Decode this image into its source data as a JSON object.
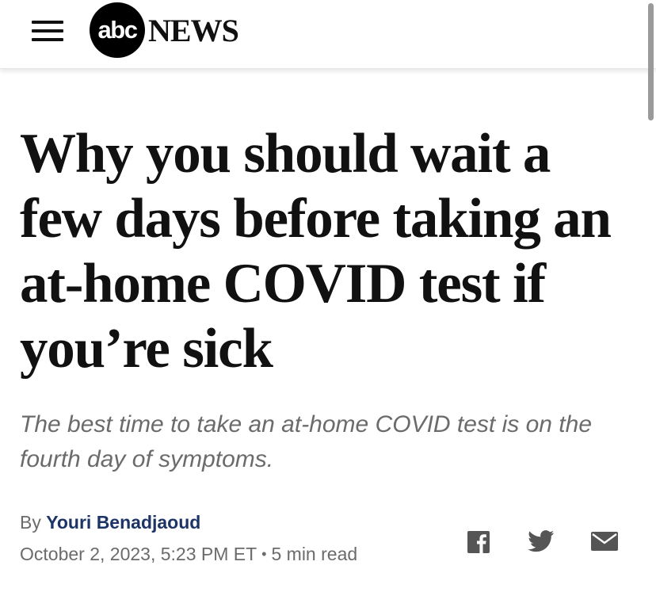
{
  "header": {
    "logo_abc": "abc",
    "logo_news": "NEWS"
  },
  "article": {
    "headline": "Why you should wait a few days before taking an at-home COVID test if you’re sick",
    "subheadline": "The best time to take an at-home COVID test is on the fourth day of symptoms.",
    "byline_prefix": "By",
    "author": "Youri Benadjaoud",
    "date": "October 2, 2023, 5:23 PM ET",
    "separator": "•",
    "read_time": "5 min read"
  },
  "share": {
    "icons": [
      "facebook-icon",
      "twitter-icon",
      "email-icon"
    ]
  },
  "colors": {
    "author_link": "#1d3466",
    "meta_text": "#6b6b6b",
    "icon": "#555555"
  }
}
